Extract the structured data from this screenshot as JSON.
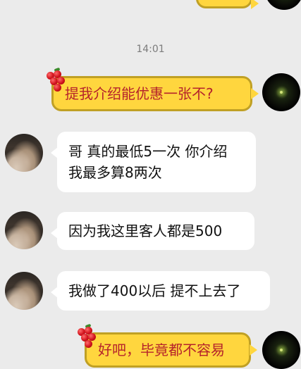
{
  "chat": {
    "timestamp": "14:01",
    "messages": [
      {
        "from": "self",
        "text": "提我介绍能优惠一张不?"
      },
      {
        "from": "other",
        "line1": "哥 真的最低5一次 你介绍",
        "line2": "我最多算8两次"
      },
      {
        "from": "other",
        "text": "因为我这里客人都是500"
      },
      {
        "from": "other",
        "text": "我做了400以后 提不上去了"
      },
      {
        "from": "self",
        "text": "好吧，毕竟都不容易"
      }
    ]
  },
  "colors": {
    "background": "#ebebeb",
    "self_bubble": "#ffd63e",
    "self_text": "#b5232b",
    "other_bubble": "#ffffff"
  },
  "icons": {
    "sticker": "red-grapes-icon"
  }
}
